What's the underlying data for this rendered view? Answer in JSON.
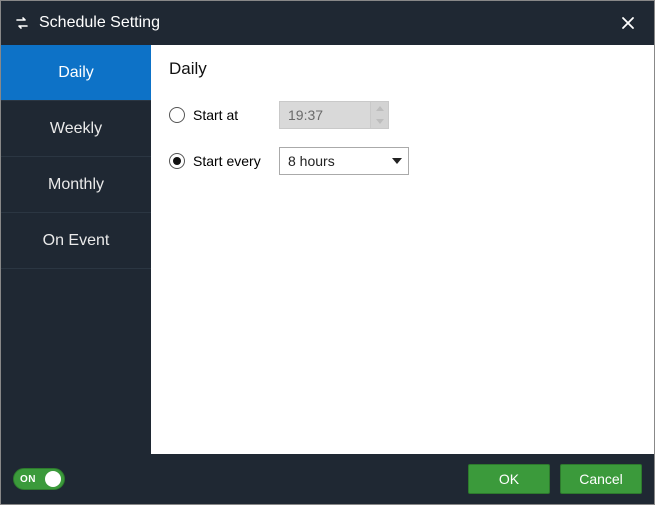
{
  "title": "Schedule Setting",
  "sidebar": {
    "items": [
      {
        "label": "Daily",
        "active": true
      },
      {
        "label": "Weekly",
        "active": false
      },
      {
        "label": "Monthly",
        "active": false
      },
      {
        "label": "On Event",
        "active": false
      }
    ]
  },
  "panel": {
    "heading": "Daily",
    "start_at": {
      "label": "Start at",
      "value": "19:37",
      "selected": false
    },
    "start_every": {
      "label": "Start every",
      "value": "8 hours",
      "selected": true
    }
  },
  "footer": {
    "toggle_label": "ON",
    "toggle_on": true,
    "ok_label": "OK",
    "cancel_label": "Cancel"
  }
}
